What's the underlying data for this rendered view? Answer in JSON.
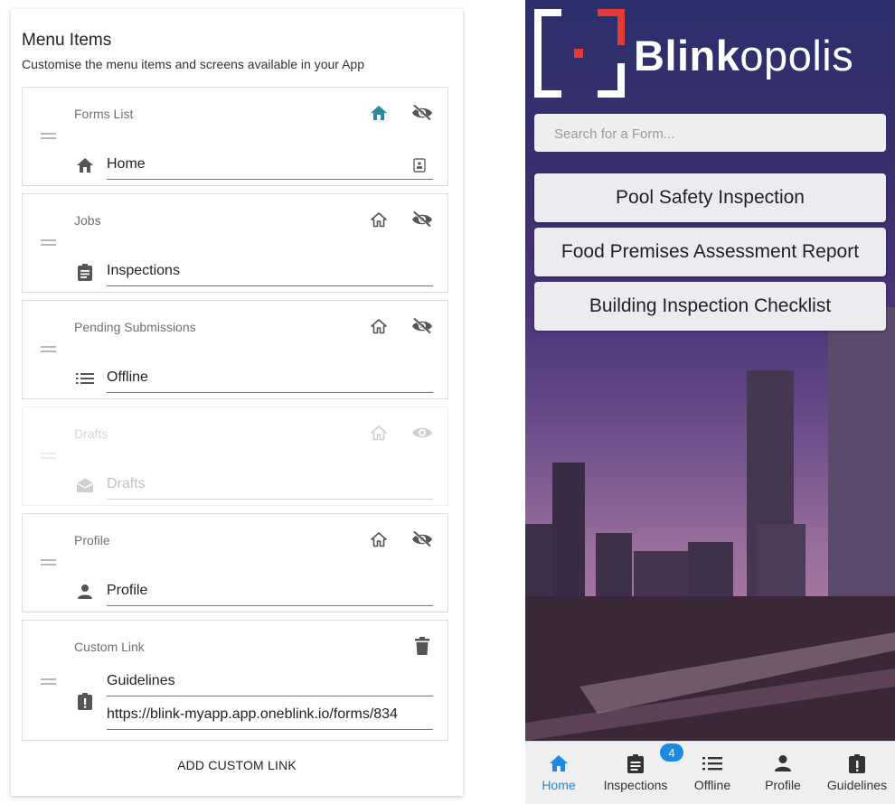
{
  "colors": {
    "accent": "#2a8aa0",
    "icon_gray": "#555555",
    "tab_active": "#1e88e5"
  },
  "menu_panel": {
    "title": "Menu Items",
    "subtitle": "Customise the menu items and screens available in your App",
    "items": [
      {
        "label": "Forms List",
        "name": "Home",
        "icon": "home-icon",
        "home_icon": "home-filled-icon",
        "home_active": true,
        "visibility_icon": "eye-off-icon",
        "trailing_icon": "badge-icon",
        "disabled": false
      },
      {
        "label": "Jobs",
        "name": "Inspections",
        "icon": "clipboard-icon",
        "home_icon": "home-outline-icon",
        "home_active": false,
        "visibility_icon": "eye-off-icon",
        "disabled": false
      },
      {
        "label": "Pending Submissions",
        "name": "Offline",
        "icon": "list-icon",
        "home_icon": "home-outline-icon",
        "home_active": false,
        "visibility_icon": "eye-off-icon",
        "disabled": false
      },
      {
        "label": "Drafts",
        "name": "Drafts",
        "icon": "drafts-envelope-icon",
        "home_icon": "home-outline-icon",
        "home_active": false,
        "visibility_icon": "eye-icon",
        "disabled": true
      },
      {
        "label": "Profile",
        "name": "Profile",
        "icon": "person-icon",
        "home_icon": "home-outline-icon",
        "home_active": false,
        "visibility_icon": "eye-off-icon",
        "disabled": false
      }
    ],
    "custom_link": {
      "label": "Custom Link",
      "name": "Guidelines",
      "url": "https://blink-myapp.app.oneblink.io/forms/834",
      "icon": "clipboard-alert-icon",
      "delete_icon": "trash-icon"
    },
    "add_button": "ADD CUSTOM LINK"
  },
  "phone": {
    "logo_bold": "Blink",
    "logo_light": "opolis",
    "search_placeholder": "Search for a Form...",
    "forms": [
      "Pool Safety Inspection",
      "Food Premises Assessment Report",
      "Building Inspection Checklist"
    ],
    "tabs": [
      {
        "label": "Home",
        "icon": "home-icon",
        "active": true
      },
      {
        "label": "Inspections",
        "icon": "clipboard-icon",
        "active": false,
        "badge": "4"
      },
      {
        "label": "Offline",
        "icon": "list-icon",
        "active": false
      },
      {
        "label": "Profile",
        "icon": "person-icon",
        "active": false
      },
      {
        "label": "Guidelines",
        "icon": "clipboard-alert-icon",
        "active": false
      }
    ]
  }
}
